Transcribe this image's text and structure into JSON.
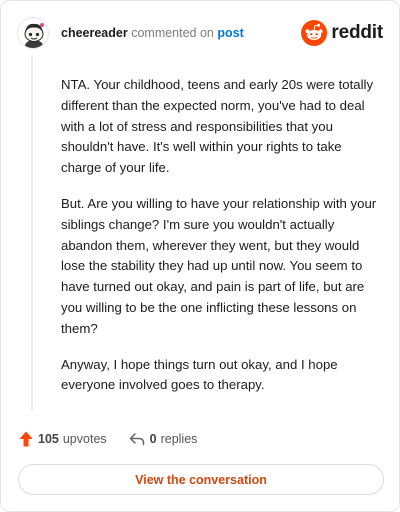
{
  "comment": {
    "username": "cheereader",
    "action_text": "commented on",
    "post_link": "post"
  },
  "brand": {
    "wordmark": "reddit",
    "icon": "reddit-alien-icon",
    "color": "#ff4500"
  },
  "body": {
    "paragraphs": [
      "NTA. Your childhood, teens and early 20s were totally different than the expected norm, you've had to deal with a lot of stress and responsibilities that you shouldn't have. It's well within your rights to take charge of your life.",
      "But. Are you willing to have your relationship with your siblings change? I'm sure you wouldn't actually abandon them, wherever they went, but they would lose the stability they had up until now. You seem to have turned out okay, and pain is part of life, but are you willing to be the one inflicting these lessons on them?",
      "Anyway, I hope things turn out okay, and I hope everyone involved goes to therapy."
    ]
  },
  "footer": {
    "upvotes_count": "105",
    "upvotes_label": "upvotes",
    "replies_count": "0",
    "replies_label": "replies",
    "upvote_icon": "upvote-arrow-icon",
    "reply_icon": "reply-arrow-icon",
    "upvote_color": "#ff4500"
  },
  "cta": {
    "label": "View the conversation",
    "color": "#cc4a13"
  }
}
